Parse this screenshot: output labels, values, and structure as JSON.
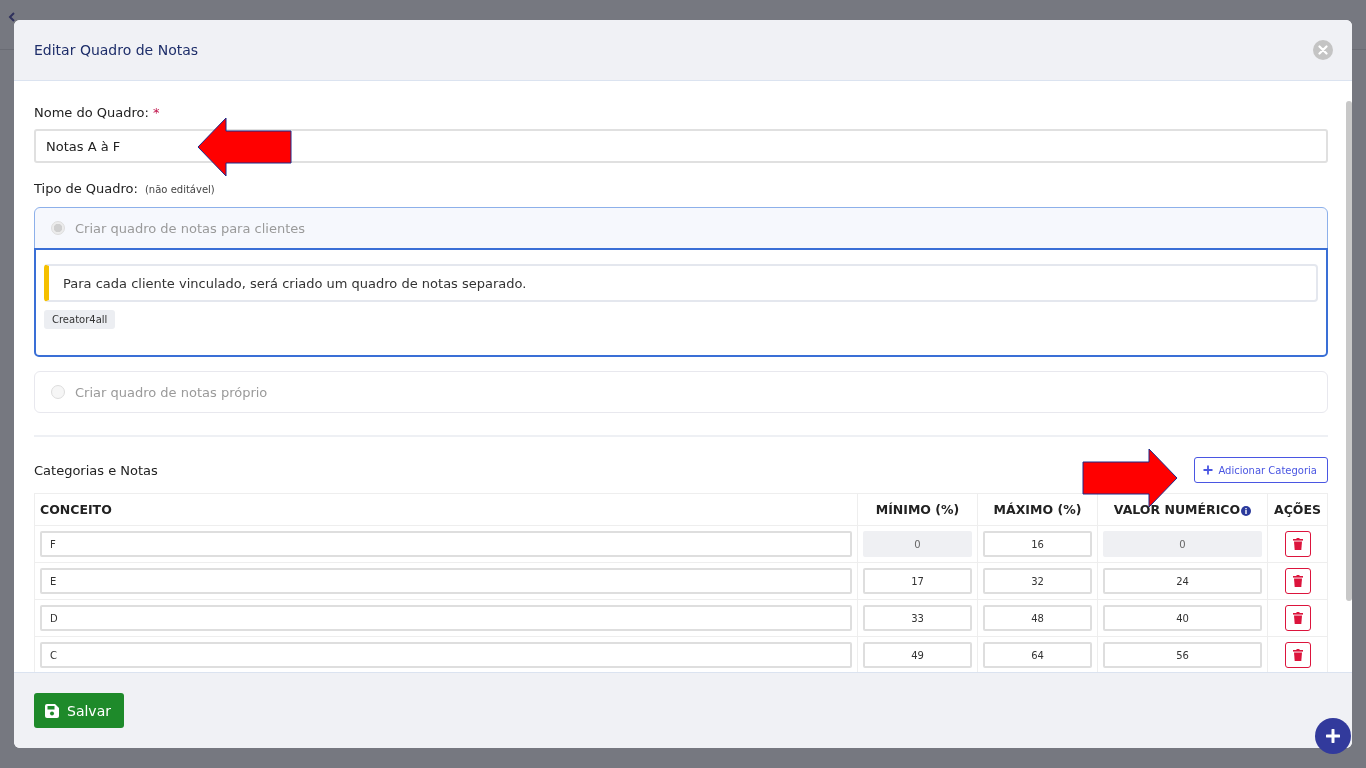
{
  "dialog": {
    "title": "Editar Quadro de Notas",
    "name_field": {
      "label": "Nome do Quadro:",
      "required_mark": "*",
      "value": "Notas A à F"
    },
    "type_section": {
      "label": "Tipo de Quadro:",
      "note": "(não editável)",
      "options": [
        {
          "label": "Criar quadro de notas para clientes",
          "selected": true,
          "disabled": true,
          "expanded": true,
          "info": "Para cada cliente vinculado, será criado um quadro de notas separado.",
          "tags": [
            "Creator4all"
          ]
        },
        {
          "label": "Criar quadro de notas próprio",
          "selected": false,
          "disabled": true,
          "expanded": false
        }
      ]
    },
    "categories": {
      "title": "Categorias e Notas",
      "add_button": "Adicionar Categoria",
      "columns": [
        {
          "label": "CONCEITO",
          "info": false
        },
        {
          "label": "MÍNIMO (%)",
          "info": false
        },
        {
          "label": "MÁXIMO (%)",
          "info": false
        },
        {
          "label": "VALOR NUMÉRICO",
          "info": true
        },
        {
          "label": "AÇÕES",
          "info": false
        }
      ],
      "rows": [
        {
          "concept": "F",
          "min": "0",
          "max": "16",
          "value": "0",
          "locked": true
        },
        {
          "concept": "E",
          "min": "17",
          "max": "32",
          "value": "24",
          "locked": false
        },
        {
          "concept": "D",
          "min": "33",
          "max": "48",
          "value": "40",
          "locked": false
        },
        {
          "concept": "C",
          "min": "49",
          "max": "64",
          "value": "56",
          "locked": false
        }
      ]
    },
    "save_button": "Salvar"
  }
}
